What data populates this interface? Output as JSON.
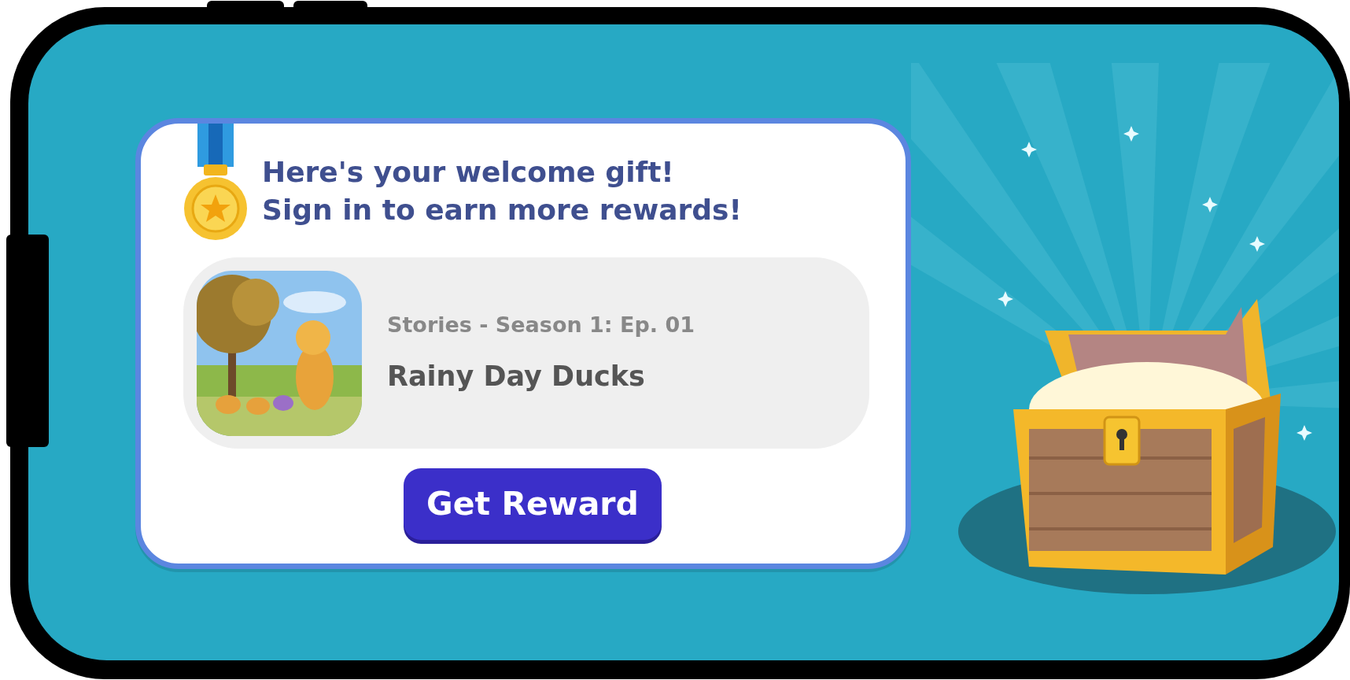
{
  "card": {
    "title_lines": [
      "Here's your welcome gift!",
      "Sign in to earn more rewards!"
    ],
    "episode": {
      "subtitle": "Stories - Season 1: Ep. 01",
      "title": "Rainy Day Ducks"
    },
    "button": "Get Reward"
  }
}
